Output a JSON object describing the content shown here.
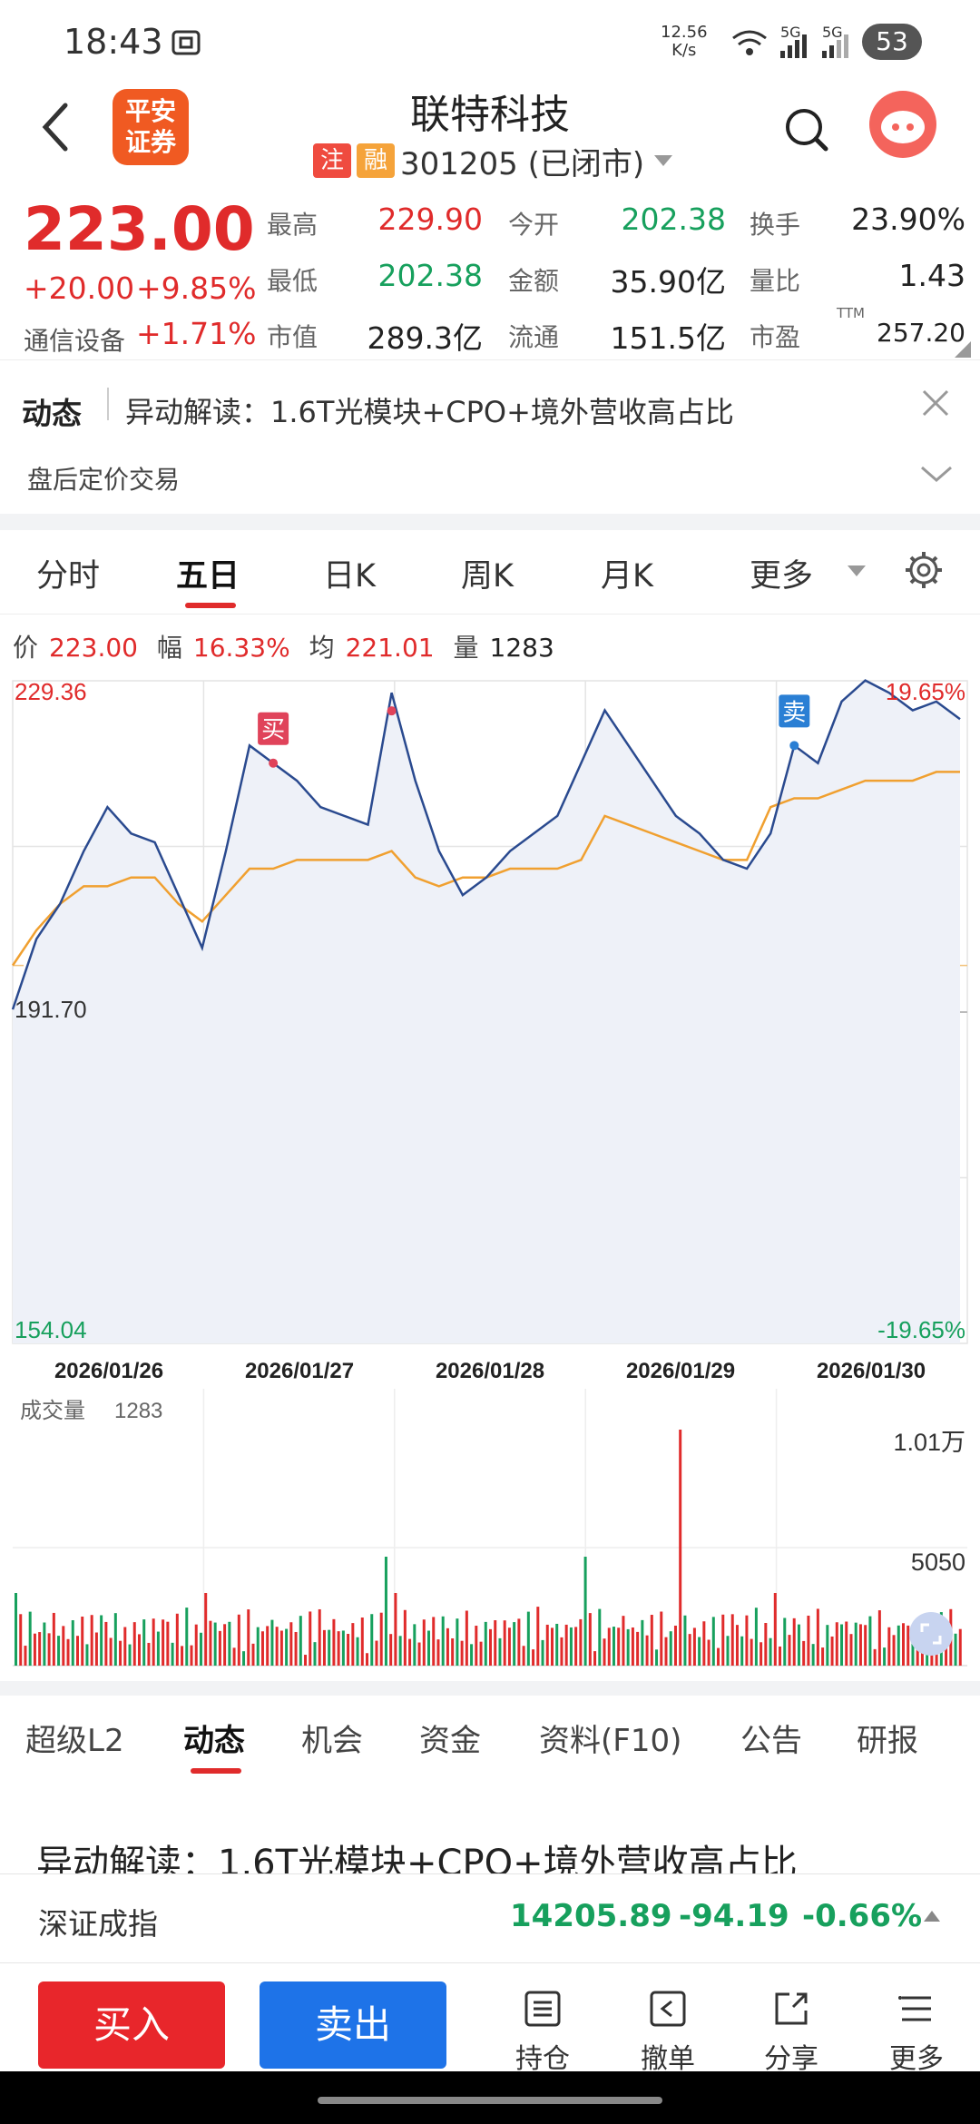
{
  "status_bar": {
    "time": "18:43",
    "net_speed_top": "12.56",
    "net_speed_bottom": "K/s",
    "signal1": "5G",
    "signal2": "5G",
    "battery": "53"
  },
  "header": {
    "title": "联特科技",
    "broker_logo": "平安证券",
    "tag1": "注",
    "tag2": "融",
    "code": "301205 (已闭市)"
  },
  "quote": {
    "price": "223.00",
    "change": "+20.00",
    "change_pct": "+9.85%",
    "sector": "通信设备",
    "sector_pct": "+1.71%",
    "rows": [
      {
        "l1": "最高",
        "v1": "229.90",
        "l2": "今开",
        "v2": "202.38",
        "l3": "换手",
        "v3": "23.90%"
      },
      {
        "l1": "最低",
        "v1": "202.38",
        "l2": "金额",
        "v2": "35.90亿",
        "l3": "量比",
        "v3": "1.43"
      },
      {
        "l1": "市值",
        "v1": "289.3亿",
        "l2": "流通",
        "v2": "151.5亿",
        "l3": "市盈",
        "v3": "257.20"
      }
    ],
    "ttm": "TTM"
  },
  "news": {
    "label": "动态",
    "text": "异动解读：1.6T光模块+CPO+境外营收高占比",
    "after_hours": "盘后定价交易"
  },
  "chart_tabs": [
    "分时",
    "五日",
    "日K",
    "周K",
    "月K",
    "更多"
  ],
  "chart_tabs_active": "五日",
  "info_line": {
    "price_label": "价",
    "price": "223.00",
    "amp_label": "幅",
    "amp": "16.33%",
    "avg_label": "均",
    "avg": "221.01",
    "vol_label": "量",
    "vol": "1283"
  },
  "chart_data": {
    "type": "line",
    "ylim": [
      154.04,
      229.36
    ],
    "y_top_label": "229.36",
    "y_mid_label": "191.70",
    "y_bottom_label": "154.04",
    "pct_top_label": "19.65%",
    "pct_bottom_label": "-19.65%",
    "x_labels": [
      "2026/01/26",
      "2026/01/27",
      "2026/01/28",
      "2026/01/29",
      "2026/01/30"
    ],
    "series": [
      {
        "values": [
          192,
          200,
          204,
          210,
          215,
          212,
          211,
          205,
          199,
          210,
          222,
          220,
          218,
          215,
          214,
          213,
          228,
          218,
          210,
          205,
          207,
          210,
          212,
          214,
          220,
          226,
          222,
          218,
          214,
          212,
          209,
          208,
          212,
          222,
          220,
          227,
          229.4,
          228,
          226,
          227,
          225
        ]
      },
      {
        "values": [
          197,
          201,
          204,
          206,
          206,
          207,
          207,
          204,
          202,
          205,
          208,
          208,
          209,
          209,
          209,
          209,
          210,
          207,
          206,
          207,
          207,
          208,
          208,
          208,
          209,
          214,
          213,
          212,
          211,
          210,
          209,
          209,
          215,
          216,
          216,
          217,
          218,
          218,
          218,
          219,
          219
        ]
      }
    ],
    "markers": [
      {
        "text": "买",
        "type": "buy"
      },
      {
        "text": "买",
        "type": "buy"
      },
      {
        "text": "卖",
        "type": "sell"
      }
    ],
    "volume": {
      "label": "成交量",
      "value": "1283",
      "max_label": "1.01万",
      "mid_label": "5050"
    }
  },
  "bottom_tabs": [
    "超级L2",
    "动态",
    "机会",
    "资金",
    "资料(F10)",
    "公告",
    "研报"
  ],
  "bottom_tabs_active": "动态",
  "news_preview": "异动解读：1.6T光模块+CPO+境外营收高占比",
  "index_bar": {
    "name": "深证成指",
    "value": "14205.89",
    "change": "-94.19",
    "change_pct": "-0.66%"
  },
  "actions": {
    "buy": "买入",
    "sell": "卖出",
    "hold": "持仓",
    "cancel": "撤单",
    "share": "分享",
    "more": "更多"
  },
  "colors": {
    "up": "#e02b2b",
    "down": "#17a05d",
    "price_line": "#2a4a8f",
    "avg_line": "#f0a030",
    "buy_button": "#e8262b",
    "sell_button": "#1e73e8"
  }
}
